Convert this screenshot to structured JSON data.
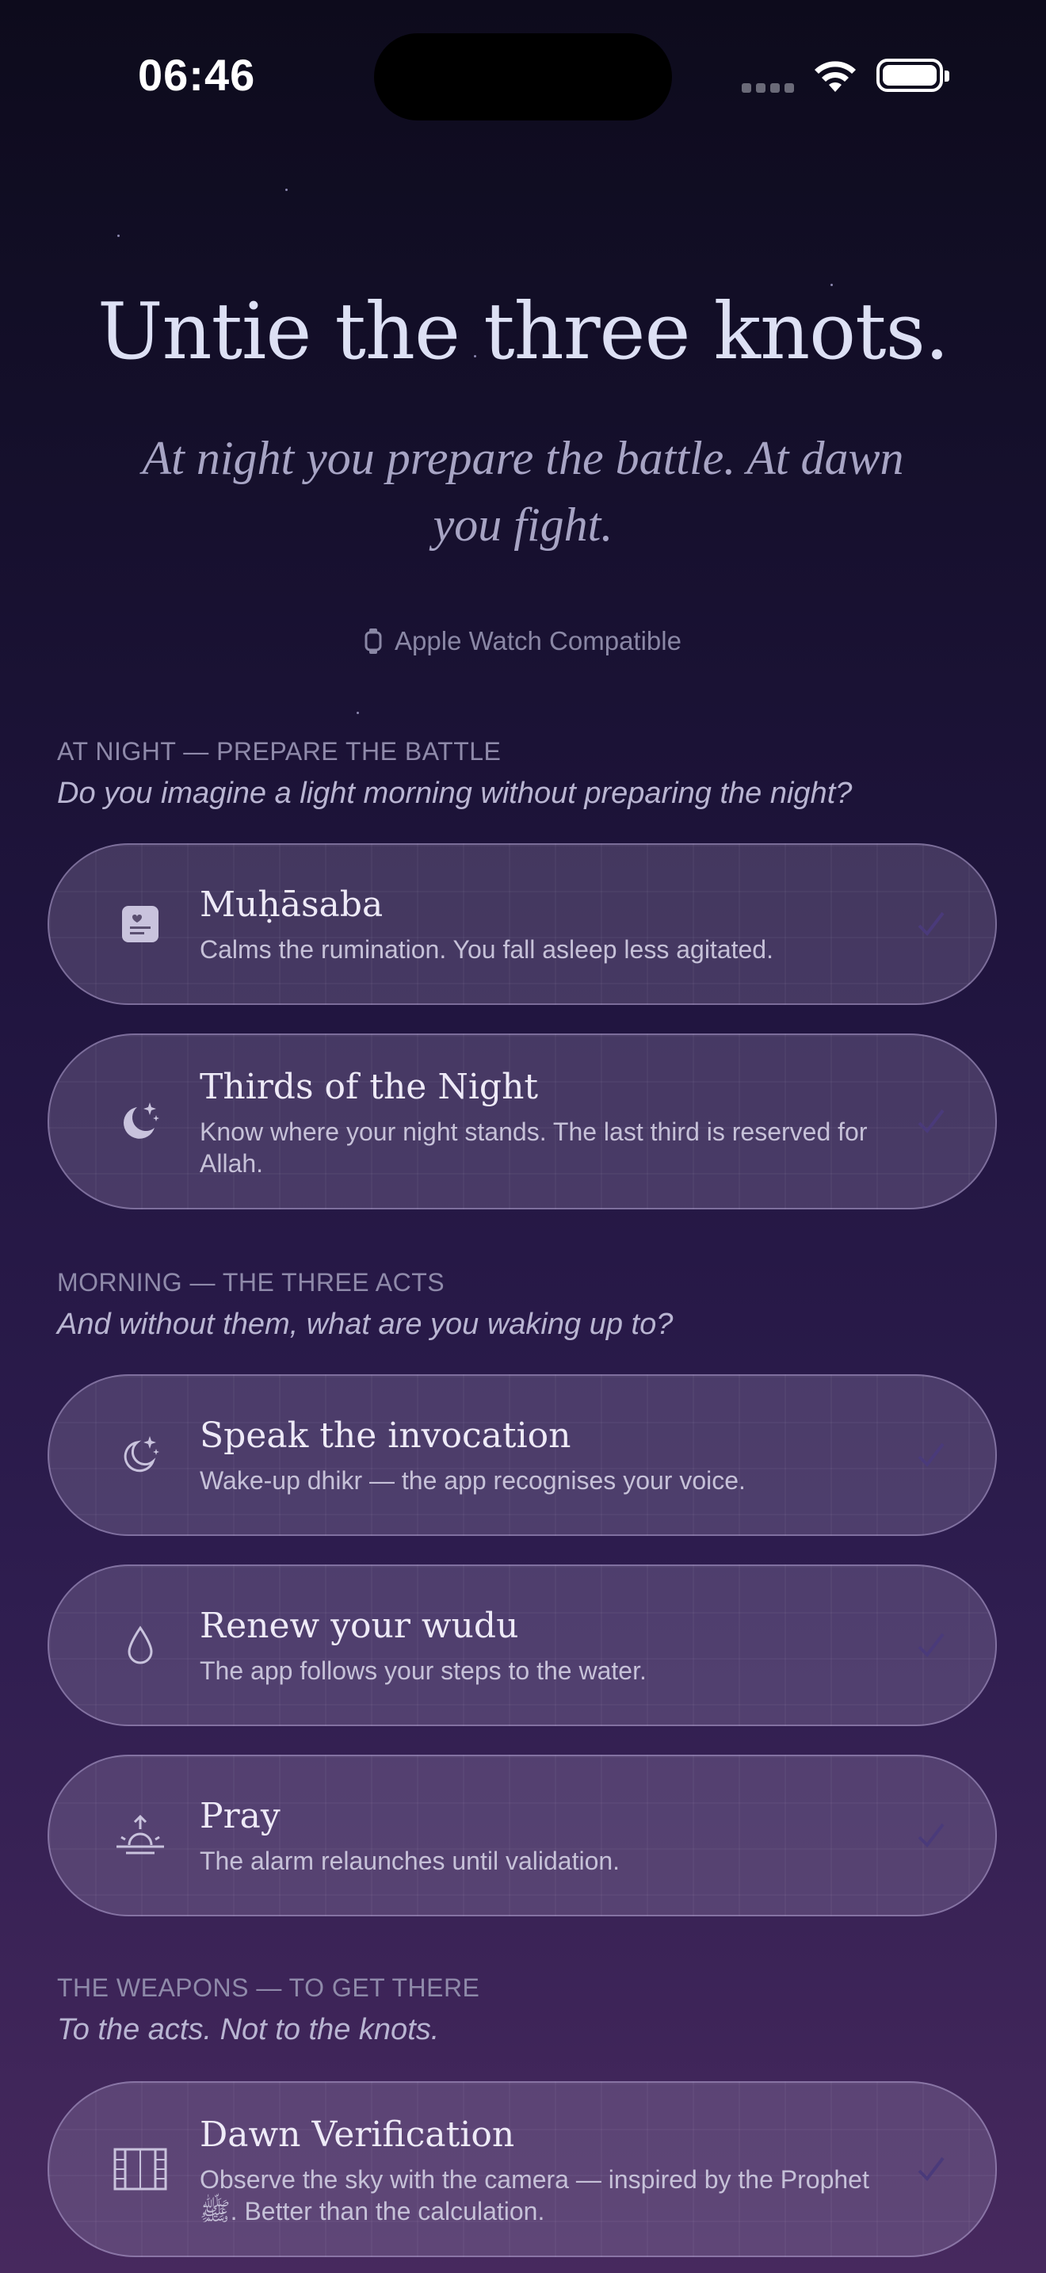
{
  "status": {
    "time": "06:46"
  },
  "hero": {
    "title": "Untie the three knots.",
    "subtitle": "At night you prepare the battle. At dawn you fight.",
    "watch_label": "Apple Watch Compatible"
  },
  "sections": [
    {
      "label": "AT NIGHT — PREPARE THE BATTLE",
      "quote": "Do you imagine a light morning without preparing the night?",
      "items": [
        {
          "icon": "journal-heart-icon",
          "title": "Muḥāsaba",
          "desc": "Calms the rumination. You fall asleep less agitated."
        },
        {
          "icon": "moon-stars-icon",
          "title": "Thirds of the Night",
          "desc": "Know where your night stands. The last third is reserved for Allah."
        }
      ]
    },
    {
      "label": "MORNING — THE THREE ACTS",
      "quote": "And without them, what are you waking up to?",
      "items": [
        {
          "icon": "moon-stars-outline-icon",
          "title": "Speak the invocation",
          "desc": "Wake-up dhikr — the app recognises your voice."
        },
        {
          "icon": "water-drop-icon",
          "title": "Renew your wudu",
          "desc": "The app follows your steps to the water."
        },
        {
          "icon": "sunrise-icon",
          "title": "Pray",
          "desc": "The alarm relaunches until validation."
        }
      ]
    },
    {
      "label": "THE WEAPONS — TO GET THERE",
      "quote": "To the acts. Not to the knots.",
      "items": [
        {
          "icon": "film-strip-icon",
          "title": "Dawn Verification",
          "desc": "Observe the sky with the camera — inspired by the Prophet ﷺ. Better than the calculation."
        }
      ]
    }
  ],
  "colors": {
    "check": "#4a3a7a",
    "icon": "#c9c3dd"
  }
}
